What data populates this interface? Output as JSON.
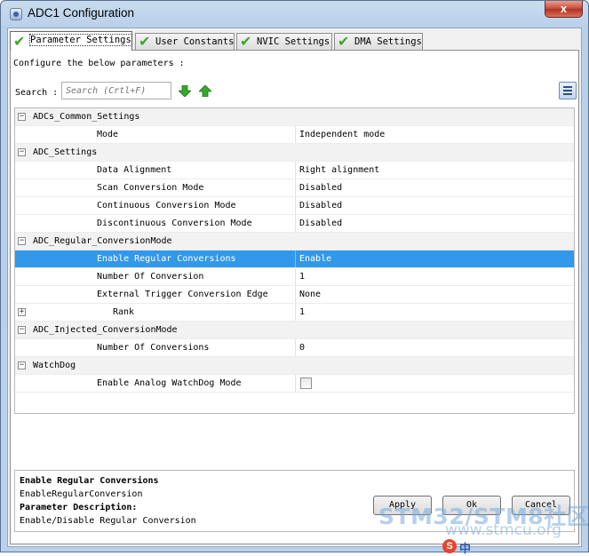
{
  "window": {
    "title": "ADC1 Configuration",
    "close_label": "x"
  },
  "tabs": [
    {
      "label": "Parameter Settings",
      "active": true
    },
    {
      "label": "User Constants"
    },
    {
      "label": "NVIC Settings"
    },
    {
      "label": "DMA Settings"
    }
  ],
  "configure_text": "Configure the below parameters :",
  "search": {
    "label": "Search :",
    "placeholder": "Search (Crtl+F)"
  },
  "params": {
    "adcs_common": {
      "group": "ADCs_Common_Settings",
      "mode": {
        "name": "Mode",
        "value": "Independent mode"
      }
    },
    "adc_settings": {
      "group": "ADC_Settings",
      "data_alignment": {
        "name": "Data Alignment",
        "value": "Right alignment"
      },
      "scan": {
        "name": "Scan Conversion Mode",
        "value": "Disabled"
      },
      "continuous": {
        "name": "Continuous Conversion Mode",
        "value": "Disabled"
      },
      "discontinuous": {
        "name": "Discontinuous Conversion Mode",
        "value": "Disabled"
      }
    },
    "regular": {
      "group": "ADC_Regular_ConversionMode",
      "enable": {
        "name": "Enable Regular Conversions",
        "value": "Enable"
      },
      "number": {
        "name": "Number Of Conversion",
        "value": "1"
      },
      "trigger_edge": {
        "name": "External Trigger Conversion Edge",
        "value": "None"
      },
      "rank": {
        "name": "Rank",
        "value": "1"
      }
    },
    "injected": {
      "group": "ADC_Injected_ConversionMode",
      "number": {
        "name": "Number Of Conversions",
        "value": "0"
      }
    },
    "watchdog": {
      "group": "WatchDog",
      "enable": {
        "name": "Enable Analog WatchDog Mode",
        "checked": false
      }
    }
  },
  "description": {
    "title": "Enable Regular Conversions",
    "id": "EnableRegularConversion",
    "param_label": "Parameter Description:",
    "text": "Enable/Disable Regular Conversion"
  },
  "buttons": {
    "apply": "Apply",
    "ok": "Ok",
    "cancel": "Cancel"
  },
  "watermark": {
    "main": "STM32/STM8社区",
    "sub": "www.stmcu.org",
    "ime_badge": "S",
    "ime_mode": "中"
  },
  "colors": {
    "selection": "#3298e9",
    "check": "#3fa52c",
    "arrow": "#3aa52f"
  }
}
